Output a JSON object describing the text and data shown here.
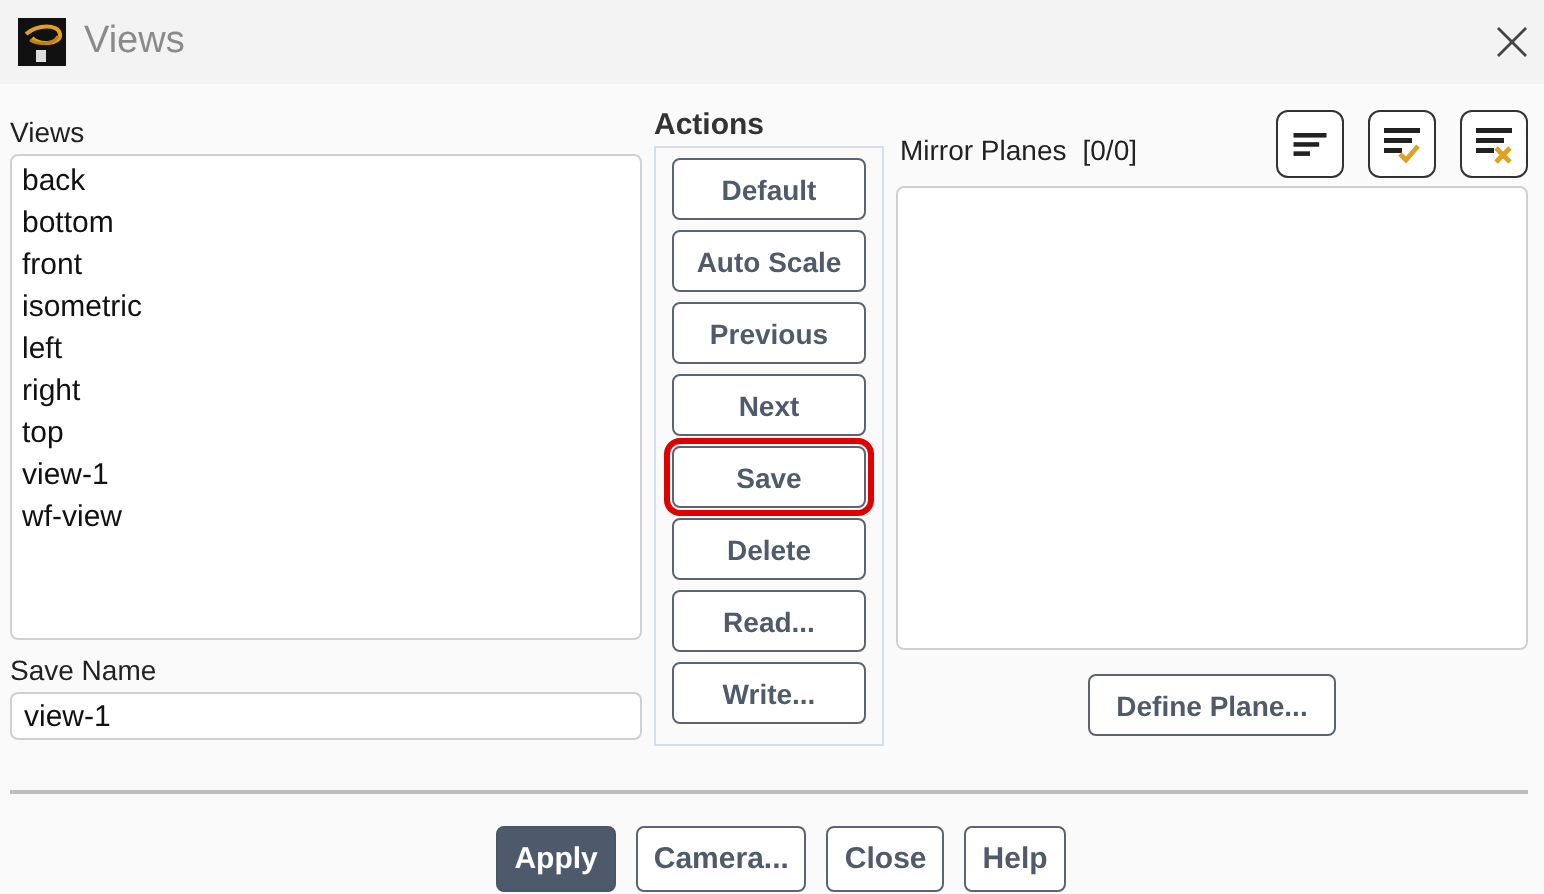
{
  "window": {
    "title": "Views"
  },
  "views": {
    "label": "Views",
    "items": [
      {
        "label": "back",
        "selected": false
      },
      {
        "label": "bottom",
        "selected": false
      },
      {
        "label": "front",
        "selected": false
      },
      {
        "label": "isometric",
        "selected": false
      },
      {
        "label": "left",
        "selected": false
      },
      {
        "label": "right",
        "selected": false
      },
      {
        "label": "top",
        "selected": false
      },
      {
        "label": "view-1",
        "selected": false
      },
      {
        "label": "wf-view",
        "selected": false
      }
    ]
  },
  "save_name": {
    "label": "Save Name",
    "value": "view-1"
  },
  "actions": {
    "label": "Actions",
    "buttons": [
      {
        "label": "Default",
        "highlighted": false
      },
      {
        "label": "Auto Scale",
        "highlighted": false
      },
      {
        "label": "Previous",
        "highlighted": false
      },
      {
        "label": "Next",
        "highlighted": false
      },
      {
        "label": "Save",
        "highlighted": true
      },
      {
        "label": "Delete",
        "highlighted": false
      },
      {
        "label": "Read...",
        "highlighted": false
      },
      {
        "label": "Write...",
        "highlighted": false
      }
    ]
  },
  "mirror_planes": {
    "label": "Mirror Planes",
    "count": "[0/0]",
    "tools": [
      {
        "kind": "list"
      },
      {
        "kind": "select-all"
      },
      {
        "kind": "deselect-all"
      }
    ],
    "define_button": "Define Plane..."
  },
  "footer_buttons": [
    {
      "label": "Apply",
      "primary": true
    },
    {
      "label": "Camera...",
      "primary": false
    },
    {
      "label": "Close",
      "primary": false
    },
    {
      "label": "Help",
      "primary": false
    }
  ]
}
